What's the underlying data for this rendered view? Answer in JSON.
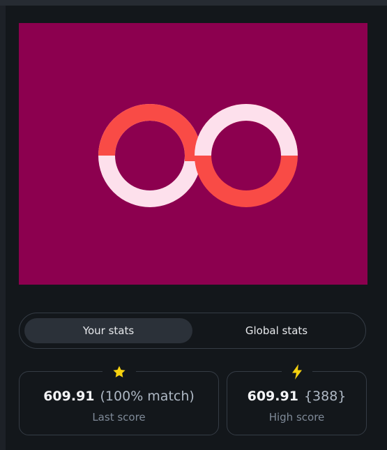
{
  "colors": {
    "target_background": "#8c004f",
    "ring_coral": "#f94b46",
    "ring_pink": "#fde0ec",
    "star": "#f7d20f",
    "bolt": "#f7d20f"
  },
  "stats_toggle": {
    "your_stats_label": "Your stats",
    "global_stats_label": "Global stats",
    "active": "your_stats"
  },
  "last_score_card": {
    "icon": "star-icon",
    "score": "609.91",
    "detail": "(100% match)",
    "label": "Last score"
  },
  "high_score_card": {
    "icon": "lightning-icon",
    "score": "609.91",
    "detail": "{388}",
    "label": "High score"
  }
}
